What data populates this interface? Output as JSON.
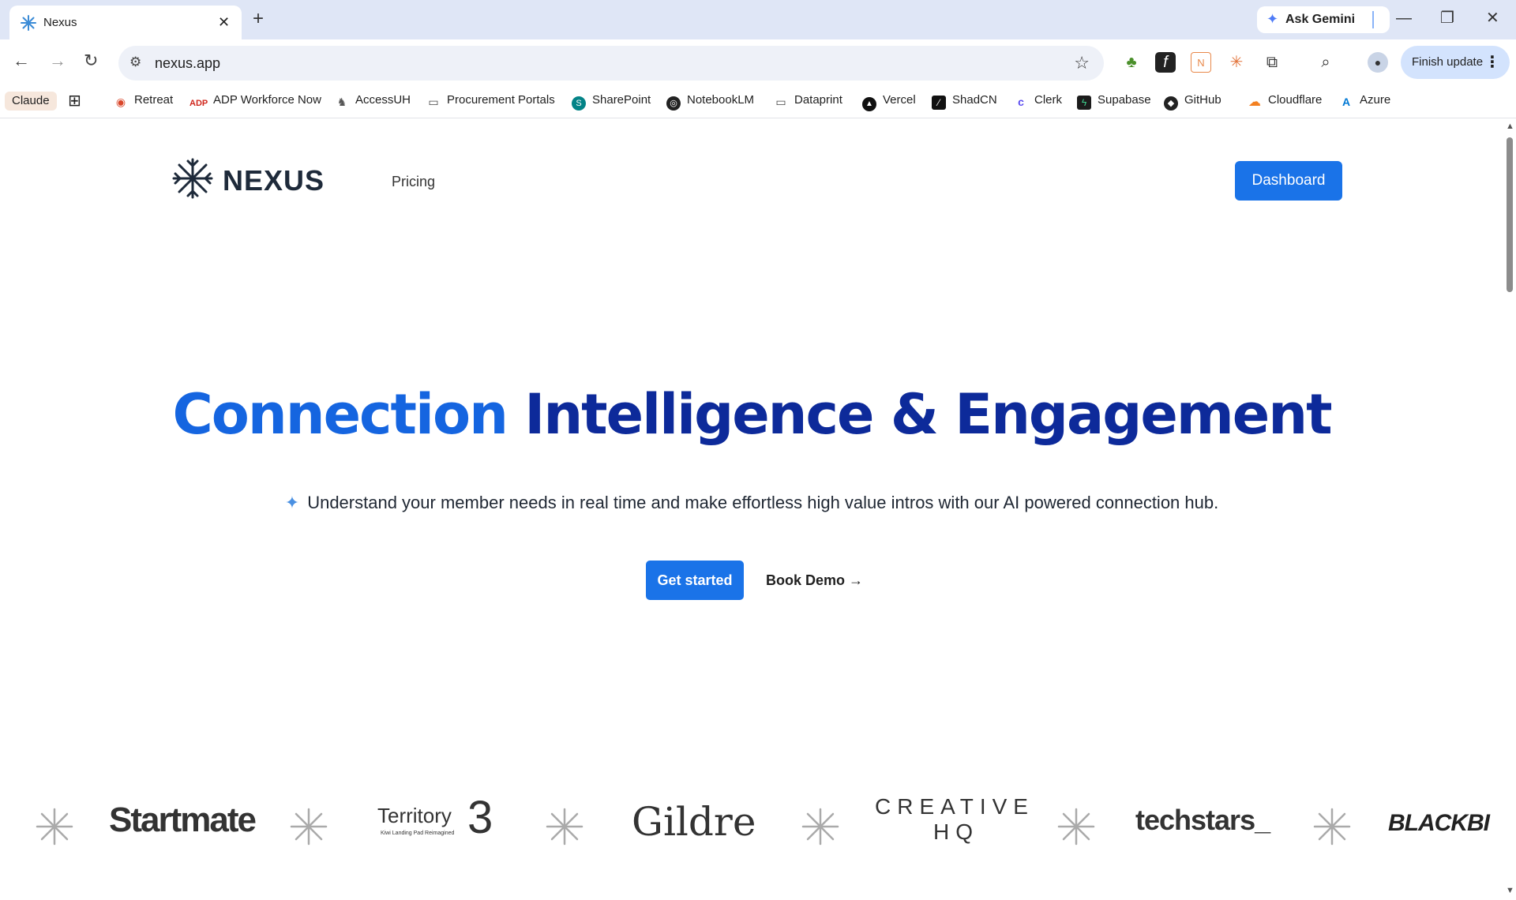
{
  "browser": {
    "tab_title": "Nexus",
    "tab_close": "✕",
    "new_tab": "+",
    "ask_gemini": "Ask Gemini",
    "url": "nexus.app",
    "finish_update": "Finish update",
    "window_controls": [
      "—",
      "❐",
      "✕"
    ]
  },
  "bookmarks": [
    {
      "label": "Claude"
    },
    {
      "label": "Retreat"
    },
    {
      "label": "ADP Workforce Now"
    },
    {
      "label": "AccessUH"
    },
    {
      "label": "Procurement Portals"
    },
    {
      "label": "SharePoint"
    },
    {
      "label": "NotebookLM"
    },
    {
      "label": "Dataprint"
    },
    {
      "label": "Vercel"
    },
    {
      "label": "ShadCN"
    },
    {
      "label": "Clerk"
    },
    {
      "label": "Supabase"
    },
    {
      "label": "GitHub"
    },
    {
      "label": "Cloudflare"
    },
    {
      "label": "Azure"
    }
  ],
  "nav": {
    "logo_text": "NEXUS",
    "pricing": "Pricing",
    "dashboard": "Dashboard"
  },
  "hero": {
    "title_part1": "Connection",
    "title_part2": "Intelligence & Engagement",
    "subtitle": "Understand your member needs in real time and make effortless high value intros with our AI powered connection hub.",
    "get_started": "Get started",
    "book_demo": "Book Demo →"
  },
  "logos": {
    "startmate": "Startmate",
    "territory": "Territory",
    "territory_num": "3",
    "territory_tag": "Kiwi Landing Pad Reimagined",
    "gildre": "Gildre",
    "creative_line1": "CREATIVE",
    "creative_line2": "HQ",
    "techstars": "techstars_",
    "blackbird": "BLACKBI"
  },
  "colors": {
    "primary": "#1a73e8",
    "hero_light": "#1565e0",
    "hero_dark": "#0d2a9a",
    "logo_dark": "#1e2a3a"
  }
}
